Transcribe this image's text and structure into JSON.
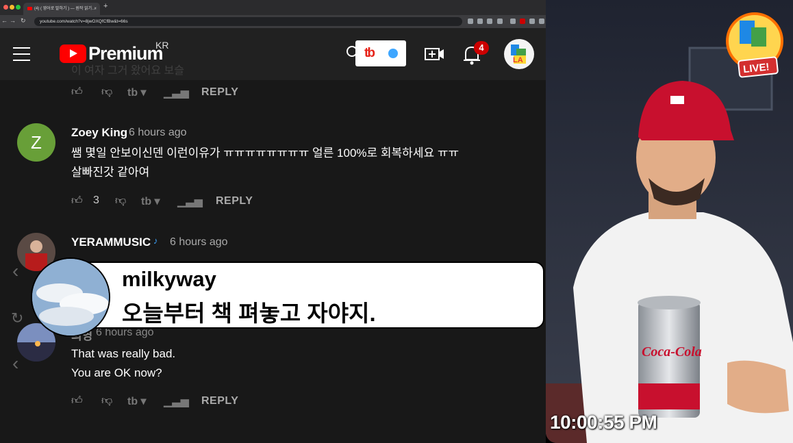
{
  "browser": {
    "tab_title": "(4) ( 영어로 말하기 ) — 원작 읽기…",
    "tab_close": "×",
    "new_tab": "+",
    "url": "youtube.com/watch?v=8jwOXQfCfBw&t=66s"
  },
  "header": {
    "brand": "Premium",
    "region": "KR",
    "notification_count": "4",
    "faint_text": "이 여자 그거 왔어요 보슬",
    "tubebuddy_label": "tb"
  },
  "comments": [
    {
      "author": "Zoey King",
      "time": "6 hours ago",
      "avatar_letter": "Z",
      "avatar_color": "#689f38",
      "lines": [
        "쌤 몇일 안보이신덴 이런이유가 ㅠㅠㅠㅠㅠㅠㅠㅠ 얼른 100%로 회복하세요 ㅠㅠ",
        "살빠진갓 같아여"
      ],
      "likes": "3"
    },
    {
      "author": "YERAMMUSIC",
      "time": "6 hours ago",
      "lines": []
    },
    {
      "author": "희영",
      "time": "6 hours ago",
      "lines": [
        "That was really bad.",
        "You are OK now?"
      ]
    }
  ],
  "actions": {
    "reply": "REPLY",
    "tb": "tb ▾"
  },
  "overlay": {
    "name": "milkyway",
    "message": "오늘부터 책 펴놓고 자야지."
  },
  "video": {
    "clock": "10:00:55 PM",
    "logo_text": "LIVE!",
    "cup_text": "Coca-Cola"
  },
  "colors": {
    "background": "#181818",
    "header": "#212121",
    "youtube_red": "#ff0000",
    "tubebuddy_blue": "#3ea6ff"
  }
}
